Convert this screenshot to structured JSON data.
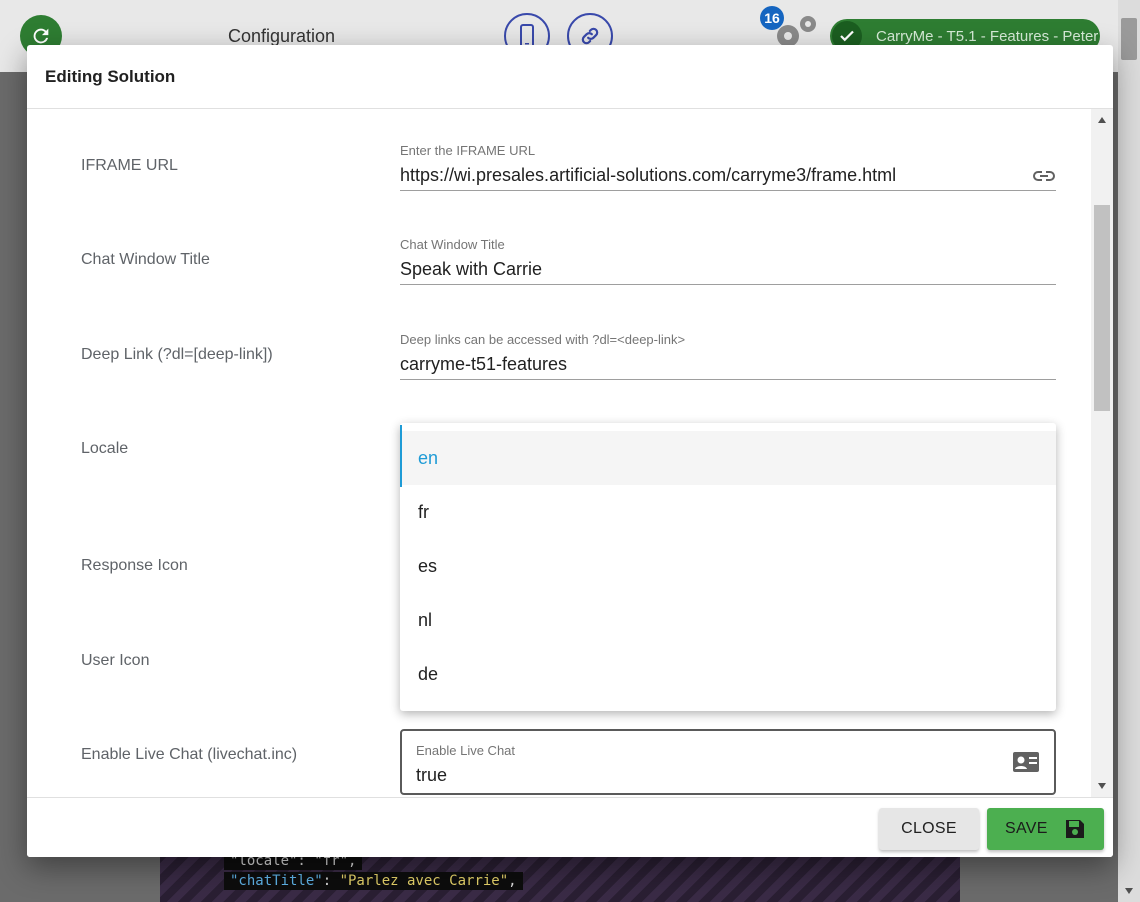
{
  "app": {
    "title": "Configuration",
    "notification_count": "16",
    "solution_label": "CarryMe - T5.1 - Features - Peter"
  },
  "background_code": {
    "line1": "\"locale\": \"fr\",",
    "line2_key": "\"chatTitle\"",
    "line2_value": "\"Parlez avec Carrie\""
  },
  "dialog": {
    "title": "Editing Solution",
    "fields": {
      "iframe_url": {
        "row_label": "IFRAME URL",
        "label": "Enter the IFRAME URL",
        "value": "https://wi.presales.artificial-solutions.com/carryme3/frame.html",
        "icon": "link-icon"
      },
      "chat_title": {
        "row_label": "Chat Window Title",
        "label": "Chat Window Title",
        "value": "Speak with Carrie"
      },
      "deep_link": {
        "row_label": "Deep Link (?dl=[deep-link])",
        "label": "Deep links can be accessed with ?dl=<deep-link>",
        "value": "carryme-t51-features"
      },
      "locale": {
        "row_label": "Locale"
      },
      "response_icon": {
        "row_label": "Response Icon"
      },
      "user_icon": {
        "row_label": "User Icon"
      },
      "live_chat": {
        "row_label": "Enable Live Chat (livechat.inc)",
        "label": "Enable Live Chat",
        "value": "true",
        "icon": "contact-card-icon"
      }
    },
    "locale_menu": {
      "options": [
        "en",
        "fr",
        "es",
        "nl",
        "de"
      ],
      "selected": "en"
    },
    "buttons": {
      "close": "CLOSE",
      "save": "SAVE"
    }
  },
  "colors": {
    "accent": "#1e9bd6",
    "save_green": "#4caf50",
    "header_green": "#2e7d32"
  }
}
